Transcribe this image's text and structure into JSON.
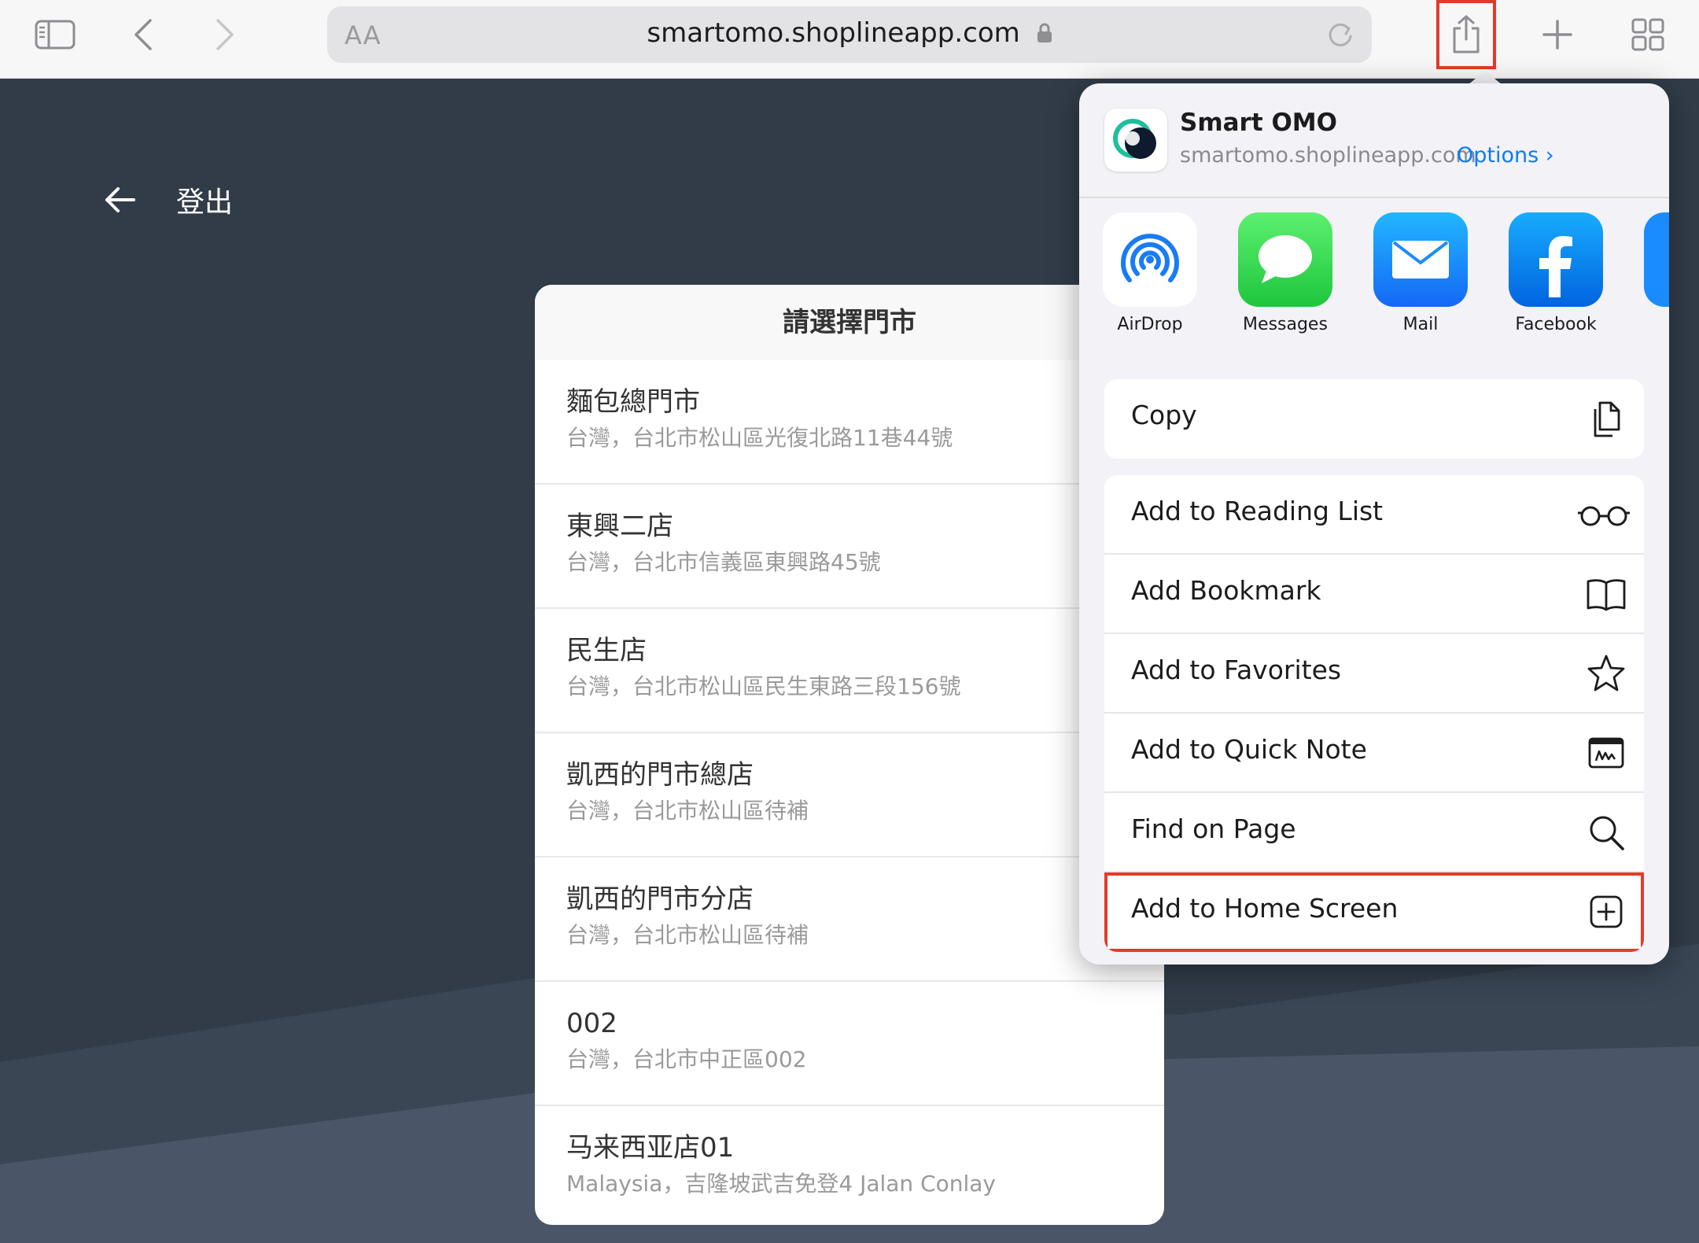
{
  "browser": {
    "url": "smartomo.shoplineapp.com",
    "text_size_label": "AA"
  },
  "page": {
    "logout_label": "登出",
    "picker_title": "請選擇門市",
    "stores": [
      {
        "name": "麵包總門市",
        "address": "台灣，台北市松山區光復北路11巷44號"
      },
      {
        "name": "東興二店",
        "address": "台灣，台北市信義區東興路45號"
      },
      {
        "name": "民生店",
        "address": "台灣，台北市松山區民生東路三段156號"
      },
      {
        "name": "凱西的門市總店",
        "address": "台灣，台北市松山區待補"
      },
      {
        "name": "凱西的門市分店",
        "address": "台灣，台北市松山區待補"
      },
      {
        "name": "002",
        "address": "台灣，台北市中正區002"
      },
      {
        "name": "马来西亚店01",
        "address": "Malaysia，吉隆坡武吉免登4 Jalan Conlay"
      }
    ]
  },
  "share_sheet": {
    "site_name": "Smart OMO",
    "site_url": "smartomo.shoplineapp.com",
    "options_label": "Options ›",
    "apps": [
      {
        "label": "AirDrop",
        "icon": "airdrop-icon"
      },
      {
        "label": "Messages",
        "icon": "messages-icon"
      },
      {
        "label": "Mail",
        "icon": "mail-icon"
      },
      {
        "label": "Facebook",
        "icon": "facebook-icon"
      }
    ],
    "copy_label": "Copy",
    "actions": [
      {
        "label": "Add to Reading List",
        "icon": "glasses-icon"
      },
      {
        "label": "Add Bookmark",
        "icon": "book-icon"
      },
      {
        "label": "Add to Favorites",
        "icon": "star-icon"
      },
      {
        "label": "Add to Quick Note",
        "icon": "quick-note-icon"
      },
      {
        "label": "Find on Page",
        "icon": "magnifier-icon"
      },
      {
        "label": "Add to Home Screen",
        "icon": "plus-square-icon"
      }
    ]
  },
  "colors": {
    "highlight": "#e23b2a",
    "link": "#0a7aff",
    "background": "#313c48"
  }
}
